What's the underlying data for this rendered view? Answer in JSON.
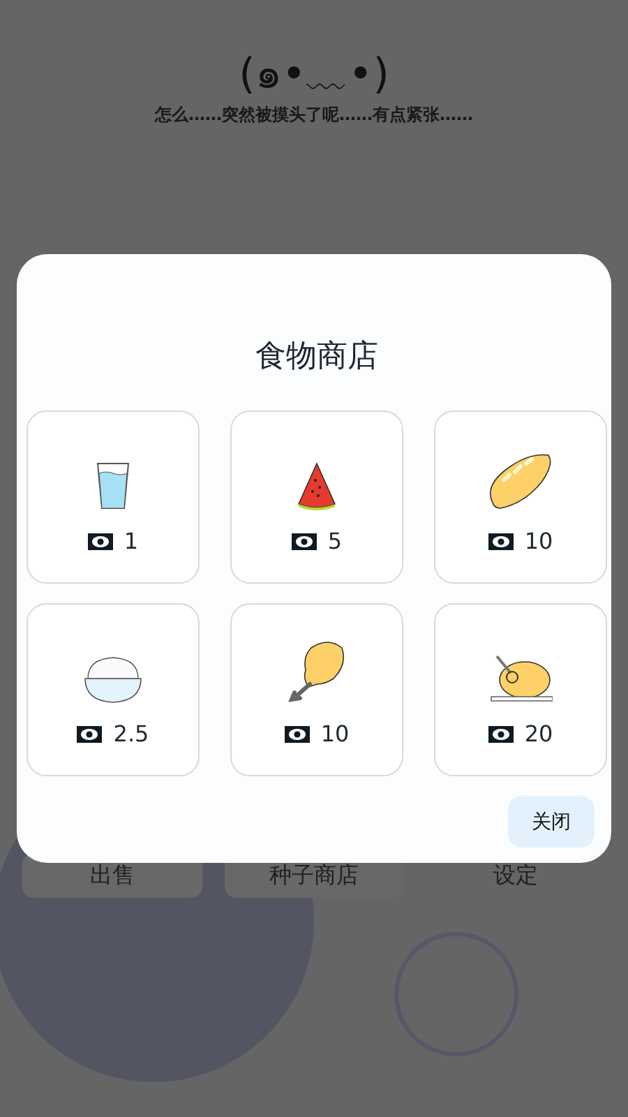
{
  "background": {
    "face": "(๑•﹏•)",
    "message": "怎么……突然被摸头了呢……有点紧张……",
    "buttons": [
      "出售",
      "种子商店",
      "设定"
    ]
  },
  "dialog": {
    "title": "食物商店",
    "items": [
      {
        "kind": "water",
        "price": "1"
      },
      {
        "kind": "watermelon",
        "price": "5"
      },
      {
        "kind": "bread",
        "price": "10"
      },
      {
        "kind": "rice",
        "price": "2.5"
      },
      {
        "kind": "drumstick",
        "price": "10"
      },
      {
        "kind": "chicken",
        "price": "20"
      }
    ],
    "close_button": "关闭"
  }
}
